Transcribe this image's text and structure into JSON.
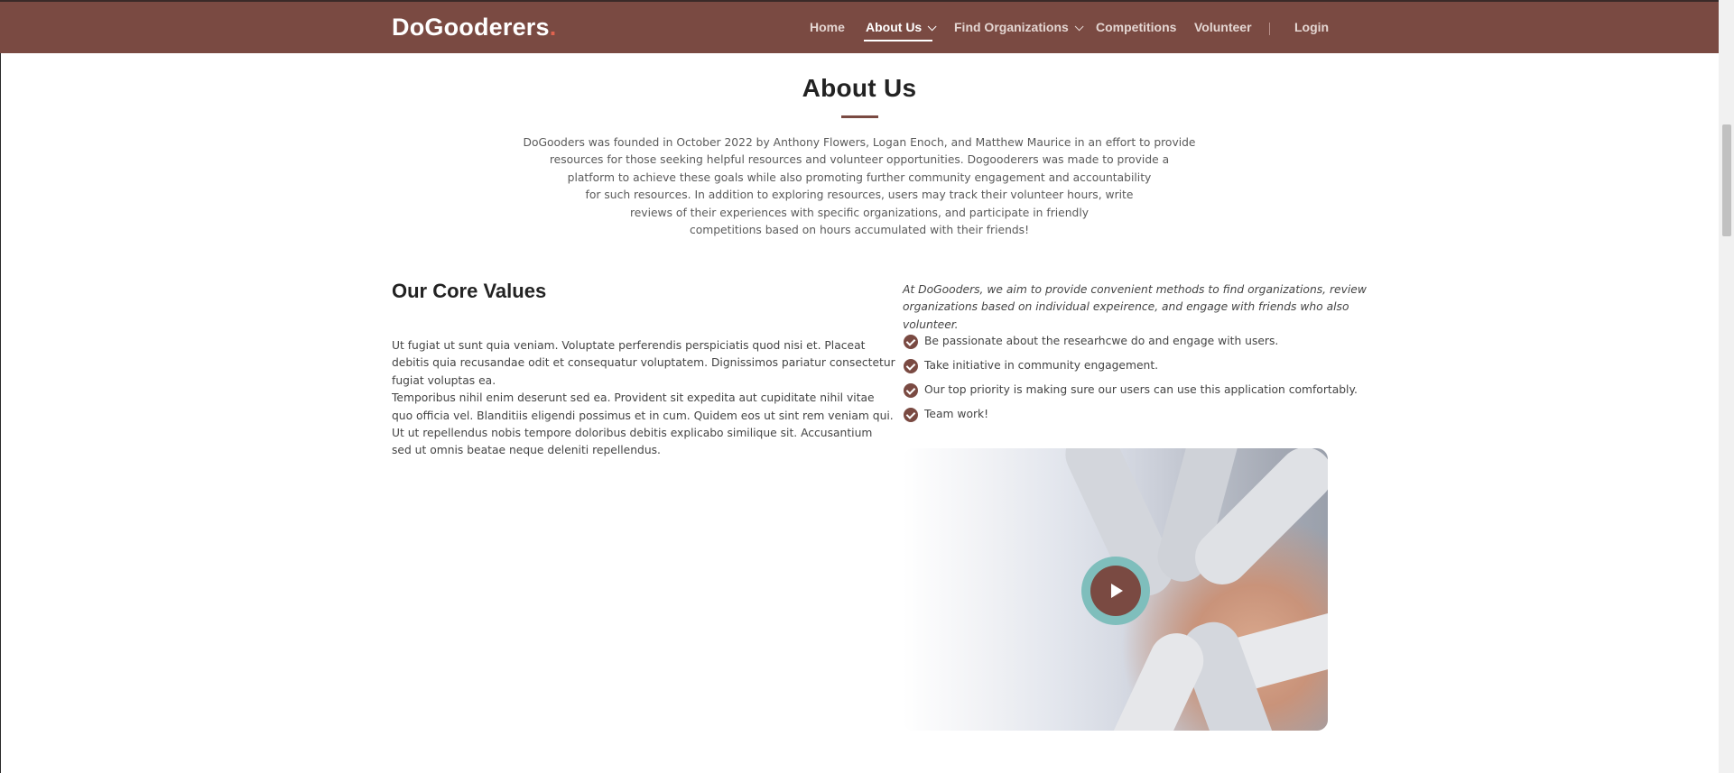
{
  "header": {
    "logo_text": "DoGooderers",
    "logo_dot": ".",
    "nav": {
      "home": "Home",
      "about": "About Us",
      "find": "Find Organizations",
      "competitions": "Competitions",
      "volunteer": "Volunteer",
      "login": "Login"
    }
  },
  "about": {
    "title": "About Us",
    "lines": [
      "DoGooders was founded in October 2022 by Anthony Flowers, Logan Enoch, and Matthew Maurice in an effort to provide",
      "resources for those seeking helpful resources and volunteer opportunities. Dogooderers was made to provide a",
      "platform to achieve these goals while also promoting further community engagement and accountability",
      "for such resources. In addition to exploring resources, users may track their volunteer hours, write",
      "reviews of their experiences with specific organizations, and participate in friendly",
      "competitions based on hours accumulated with their friends!"
    ]
  },
  "core": {
    "title": "Our Core Values",
    "lines": [
      "Ut fugiat ut sunt quia veniam. Voluptate perferendis perspiciatis quod nisi et. Placeat",
      "debitis quia recusandae odit et consequatur voluptatem. Dignissimos pariatur consectetur",
      "fugiat voluptas ea.",
      "Temporibus nihil enim deserunt sed ea. Provident sit expedita aut cupiditate nihil vitae",
      "quo officia vel. Blanditiis eligendi possimus et in cum. Quidem eos ut sint rem veniam qui.",
      "Ut ut repellendus nobis tempore doloribus debitis explicabo similique sit. Accusantium",
      "sed ut omnis beatae neque deleniti repellendus."
    ],
    "intro_lines": [
      "At DoGooders, we aim to provide convenient methods to find organizations, review",
      "organizations based on individual expeirence, and engage with friends who also",
      "volunteer."
    ],
    "checks": [
      "Be passionate about the researhcwe do and engage with users.",
      "Take initiative in community engagement.",
      "Our top priority is making sure our users can use this application comfortably.",
      "Team work!"
    ]
  },
  "colors": {
    "header_bg": "#7a4a42",
    "accent_dot": "#e0634f",
    "play_ring": "#7fbebc"
  },
  "icons": {
    "check": "check-circle-icon",
    "play": "play-icon",
    "chevron": "chevron-down-icon"
  }
}
